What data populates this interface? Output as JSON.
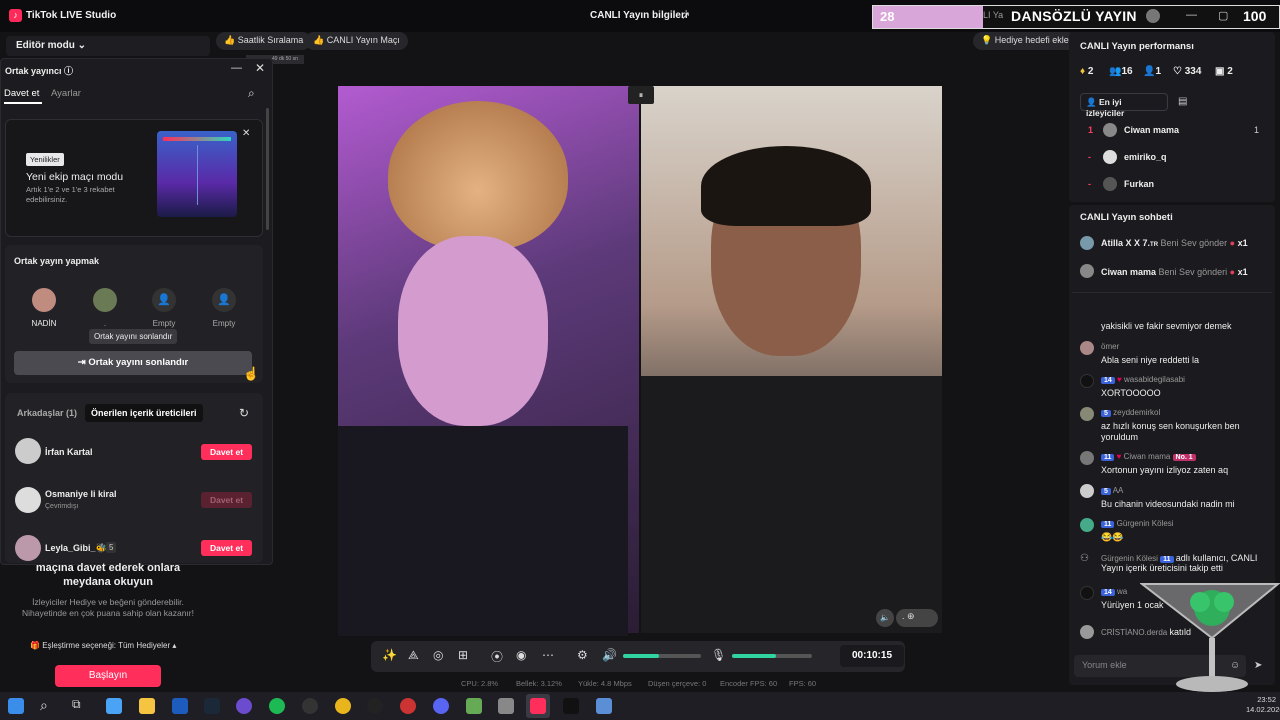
{
  "app": {
    "title": "TikTok LIVE Studio",
    "center_title": "CANLI Yayın bilgileri"
  },
  "overlay": {
    "left_number": "28",
    "partial": "LI Ya",
    "text": "DANSÖZLÜ YAYIN",
    "right_number": "100"
  },
  "toolbar_top": {
    "editor_mode": "Editör modu",
    "hourly_ranking": "Saatlik Sıralama",
    "live_match": "CANLI Yayın Maçı",
    "gift_goal": "Hediye hedefi ekle",
    "small_timer": "49 dk 50 sn"
  },
  "cohost_panel": {
    "title": "Ortak yayıncı",
    "tabs": [
      "Davet et",
      "Ayarlar"
    ],
    "promo": {
      "badge": "Yenilikler",
      "heading": "Yeni ekip maçı modu",
      "body": "Artık 1'e 2 ve 1'e 3 rekabet edebilirsiniz."
    },
    "cohost_section": {
      "title": "Ortak yayın yapmak",
      "slots": [
        {
          "label": "NADİN"
        },
        {
          "label": "."
        },
        {
          "label": "Empty"
        },
        {
          "label": "Empty"
        }
      ],
      "tooltip": "Ortak yayını sonlandır",
      "end_button": "Ortak yayını sonlandır"
    },
    "friends": {
      "tab_friends": "Arkadaşlar (1)",
      "tab_suggested": "Önerilen içerik üreticileri",
      "rows": [
        {
          "name": "İrfan Kartal",
          "sub": "",
          "badge": "",
          "button": "Davet et",
          "enabled": true
        },
        {
          "name": "Osmaniye li kiral",
          "sub": "Çevrimdışı",
          "badge": "",
          "button": "Davet et",
          "enabled": false
        },
        {
          "name": "Leyla_Gibi_🐝",
          "sub": "",
          "badge": "5",
          "button": "Davet et",
          "enabled": true
        }
      ]
    }
  },
  "match_invite": {
    "heading": "maçına davet ederek onlara meydana okuyun",
    "body": "İzleyiciler Hediye ve beğeni gönderebilir. Nihayetinde en çok puana sahip olan kazanır!",
    "option": "Eşleştirme seçeneği: Tüm Hediyeler",
    "start_button": "Başlayın"
  },
  "video": {
    "timer": "00:10:15"
  },
  "stats": {
    "cpu": "CPU:  2.8%",
    "memory": "Bellek:  3.12%",
    "upload": "Yükle:  4.8 Mbps",
    "dropped": "Düşen çerçeve:  0",
    "encoder_fps": "Encoder FPS:  60",
    "fps": "FPS:  60"
  },
  "performance": {
    "title": "CANLI Yayın performansı",
    "stats": [
      "2",
      "16",
      "1",
      "334",
      "2"
    ],
    "top_viewers_button": "En iyi izleyiciler",
    "viewers": [
      {
        "rank": "1",
        "name": "Ciwan mama",
        "score": "1"
      },
      {
        "rank": "-",
        "name": "emiriko_q",
        "score": ""
      },
      {
        "rank": "-",
        "name": "Furkan",
        "score": ""
      }
    ]
  },
  "chat": {
    "title": "CANLI Yayın sohbeti",
    "gifts": [
      {
        "name": "Atilla X X 7.",
        "suffix": "TR",
        "text": "Beni Sev gönder",
        "count": "x1"
      },
      {
        "name": "Ciwan mama",
        "suffix": "",
        "text": "Beni Sev gönderi",
        "count": "x1"
      }
    ],
    "messages": [
      {
        "name": "",
        "level": "",
        "text": "yakisikli ve fakir sevmiyor demek"
      },
      {
        "name": "ömer",
        "level": "",
        "text": "Abla seni niye reddetti la"
      },
      {
        "name": "wasabidegilasabi",
        "level": "14",
        "text": "XORTOOOOO"
      },
      {
        "name": "zeyddemirkol",
        "level": "5",
        "text": "az hızlı konuş sen konuşurken ben yoruldum"
      },
      {
        "name": "Ciwan mama",
        "level": "11",
        "text": "Xortonun yayını izliyoz zaten aq",
        "extra": "No. 1"
      },
      {
        "name": "AA",
        "level": "5",
        "text": "Bu cihanin videosundaki nadin mi"
      },
      {
        "name": "Gürgenin Kölesi",
        "level": "11",
        "text": "😂😂"
      },
      {
        "name": "Gürgenin Kölesi",
        "level": "11",
        "text": "adlı kullanıcı, CANLI Yayın içerik üreticisini takip etti"
      },
      {
        "name": "wa",
        "level": "14",
        "text": "Yürüyen 1 ocak"
      },
      {
        "name": "CRİSTİANO.derda",
        "level": "",
        "text": "katıld"
      }
    ],
    "comment_placeholder": "Yorum ekle"
  },
  "clock": {
    "time": "23:52",
    "date": "14.02.2026"
  },
  "colors": {
    "accent": "#ff2e5a",
    "green": "#2fd4a0",
    "badge_blue": "#3b62d9"
  }
}
